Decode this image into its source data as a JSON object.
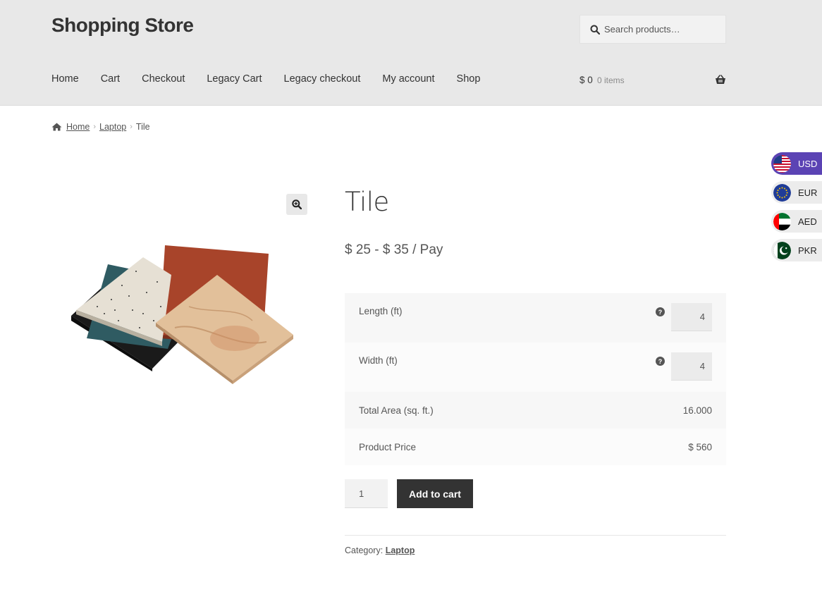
{
  "site": {
    "title": "Shopping Store"
  },
  "search": {
    "placeholder": "Search products…"
  },
  "nav": {
    "items": [
      {
        "label": "Home"
      },
      {
        "label": "Cart"
      },
      {
        "label": "Checkout"
      },
      {
        "label": "Legacy Cart"
      },
      {
        "label": "Legacy checkout"
      },
      {
        "label": "My account"
      },
      {
        "label": "Shop"
      }
    ]
  },
  "mini_cart": {
    "amount": "$ 0",
    "count": "0 items",
    "icon": "basket-icon"
  },
  "breadcrumb": {
    "home": "Home",
    "category": "Laptop",
    "current": "Tile",
    "separator": "›"
  },
  "product": {
    "title": "Tile",
    "price": "$ 25 - $ 35 / Pay",
    "length_label": "Length (ft)",
    "length_value": "4",
    "width_label": "Width (ft)",
    "width_value": "4",
    "area_label": "Total Area (sq. ft.)",
    "area_value": "16.000",
    "price_label": "Product Price",
    "price_value": "$ 560",
    "quantity": "1",
    "add_to_cart": "Add to cart",
    "category_prefix": "Category:",
    "category": "Laptop"
  },
  "currencies": [
    {
      "code": "USD",
      "active": true
    },
    {
      "code": "EUR",
      "active": false
    },
    {
      "code": "AED",
      "active": false
    },
    {
      "code": "PKR",
      "active": false
    }
  ],
  "colors": {
    "header_bg": "#e8e8e8",
    "button_bg": "#333333",
    "currency_active": "#5b43b4"
  }
}
